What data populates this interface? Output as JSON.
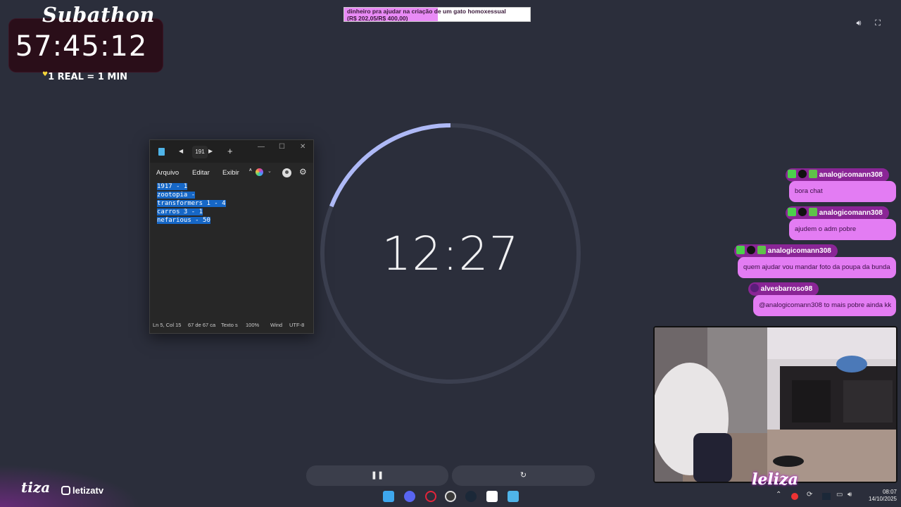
{
  "subathon": {
    "title": "Subathon",
    "timer": "57:45:12",
    "rate": "1 REAL = 1 MIN"
  },
  "goal": {
    "text_line1": "dinheiro pra ajudar na criação de um gato homoxessual",
    "text_line2": "(R$ 202,05/R$ 400,00)",
    "progress_fraction": 0.505
  },
  "notepad": {
    "tab_name": "191",
    "menu": [
      "Arquivo",
      "Editar",
      "Exibir"
    ],
    "lines": [
      "1917 - 1",
      "zootopia -",
      "transformers 1 - 4",
      "carros 3 - 1",
      "nefarious - 50"
    ],
    "status": {
      "position": "Ln 5, Col 15",
      "chars": "67 de 67 ca",
      "text_label": "Texto s",
      "zoom": "100%",
      "line_ending": "Wind",
      "encoding": "UTF-8"
    }
  },
  "timer": {
    "display": "12:27",
    "progress_fraction": 0.19,
    "accent_color": "#aeb9f6",
    "track_color": "#3b3f4f"
  },
  "chat": [
    {
      "user": "analogicomann308",
      "message": "bora chat"
    },
    {
      "user": "analogicomann308",
      "message": "ajudem o adm pobre"
    },
    {
      "user": "analogicomann308",
      "message": "quem ajudar vou mandar foto da poupa da bunda"
    },
    {
      "user": "alvesbarroso98",
      "message": "@analogicomann308 to mais pobre ainda kk"
    }
  ],
  "branding": {
    "left_logo": "tiza",
    "instagram": "letizatv",
    "cam_logo": "leliza"
  },
  "clock": {
    "time": "08:07",
    "date": "14/10/2025"
  },
  "colors": {
    "background": "#2b2e3b",
    "chat_name_bg": "#8a2596",
    "chat_msg_bg": "#e37cf3",
    "selection": "#1667c6"
  }
}
